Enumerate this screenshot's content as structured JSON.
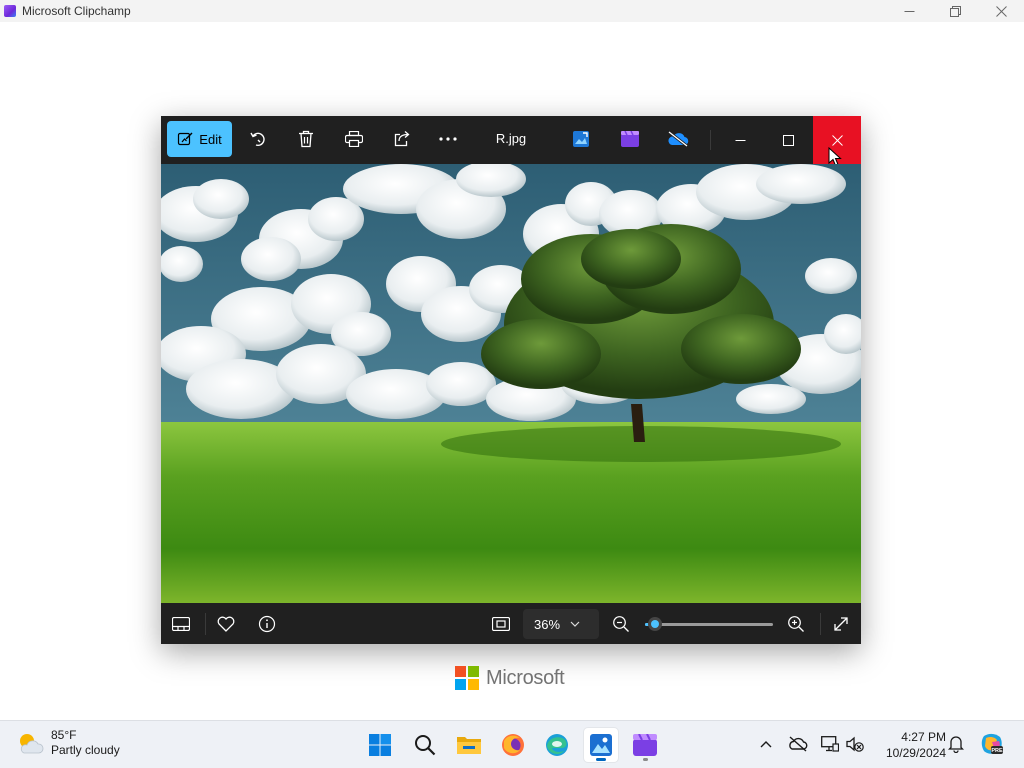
{
  "app_window": {
    "title": "Microsoft Clipchamp",
    "controls": [
      "minimize-icon",
      "restore-icon",
      "close-icon"
    ]
  },
  "photos_viewer": {
    "toolbar": {
      "edit_label": "Edit",
      "file_name": "R.jpg",
      "icons": [
        "edit-image-icon",
        "rotate-icon",
        "delete-icon",
        "print-icon",
        "share-icon",
        "more-icon",
        "photos-edit-icon",
        "clipchamp-icon",
        "onedrive-icon"
      ],
      "window_controls": [
        "minimize-icon",
        "maximize-icon",
        "close-icon"
      ],
      "accent_color": "#4cc2ff",
      "close_hover_color": "#e81123"
    },
    "image": {
      "description_icon": "landscape-image"
    },
    "bottom_bar": {
      "zoom_value": "36%",
      "zoom_slider_level": 0.08,
      "icons": [
        "filmstrip-icon",
        "favorite-icon",
        "info-icon",
        "fit-to-window-icon",
        "zoom-out-icon",
        "zoom-in-icon",
        "fullscreen-icon"
      ]
    }
  },
  "branding": {
    "logo_text": "Microsoft"
  },
  "taskbar": {
    "weather": {
      "temperature": "85°F",
      "condition": "Partly cloudy"
    },
    "apps": [
      "start-icon",
      "search-icon",
      "file-explorer-icon",
      "firefox-icon",
      "edge-icon",
      "photos-icon",
      "clipchamp-icon"
    ],
    "tray": [
      "show-hidden-icons-icon",
      "onedrive-icon",
      "network-icon",
      "volume-icon",
      "notifications-icon",
      "copilot-icon"
    ],
    "clock": {
      "time": "4:27 PM",
      "date": "10/29/2024"
    }
  }
}
